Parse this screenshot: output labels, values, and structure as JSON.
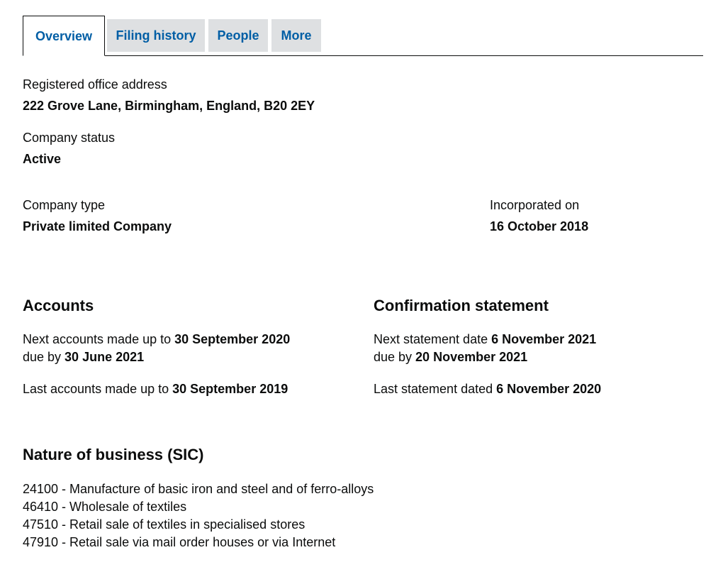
{
  "tabs": [
    {
      "label": "Overview",
      "active": true
    },
    {
      "label": "Filing history",
      "active": false
    },
    {
      "label": "People",
      "active": false
    },
    {
      "label": "More",
      "active": false
    }
  ],
  "registered_office": {
    "label": "Registered office address",
    "value": "222 Grove Lane, Birmingham, England, B20 2EY"
  },
  "company_status": {
    "label": "Company status",
    "value": "Active"
  },
  "company_type": {
    "label": "Company type",
    "value": "Private limited Company"
  },
  "incorporated": {
    "label": "Incorporated on",
    "value": "16 October 2018"
  },
  "accounts": {
    "heading": "Accounts",
    "next_prefix": "Next accounts made up to ",
    "next_date": "30 September 2020",
    "due_prefix": "due by ",
    "due_date": "30 June 2021",
    "last_prefix": "Last accounts made up to ",
    "last_date": "30 September 2019"
  },
  "confirmation": {
    "heading": "Confirmation statement",
    "next_prefix": "Next statement date ",
    "next_date": "6 November 2021",
    "due_prefix": "due by ",
    "due_date": "20 November 2021",
    "last_prefix": "Last statement dated ",
    "last_date": "6 November 2020"
  },
  "sic": {
    "heading": "Nature of business (SIC)",
    "items": [
      "24100 - Manufacture of basic iron and steel and of ferro-alloys",
      "46410 - Wholesale of textiles",
      "47510 - Retail sale of textiles in specialised stores",
      "47910 - Retail sale via mail order houses or via Internet"
    ]
  }
}
